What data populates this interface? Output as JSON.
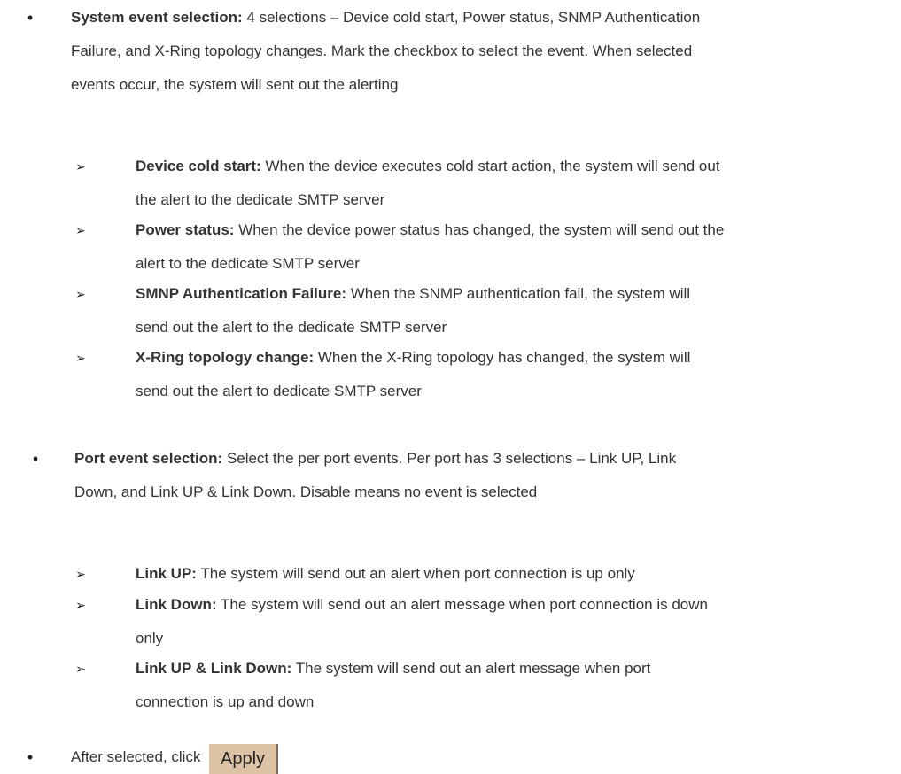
{
  "system_event": {
    "title": "System event selection:",
    "line1": " 4 selections – Device cold start, Power status, SNMP Authentication",
    "line2": "Failure, and X-Ring topology changes. Mark the checkbox to select the event. When selected",
    "line3": "events occur, the system will sent out the alerting",
    "items": [
      {
        "title": "Device cold start:",
        "line1": " When the device executes cold start action, the system will send out",
        "line2": "the alert to the dedicate SMTP server"
      },
      {
        "title": "Power status:",
        "line1": " When the device power status has changed, the system will send out the",
        "line2": "alert to the dedicate SMTP server"
      },
      {
        "title": "SMNP Authentication Failure:",
        "line1": " When the SNMP authentication fail, the system will",
        "line2": "send out the alert to the dedicate SMTP server"
      },
      {
        "title": "X-Ring topology change:",
        "line1": " When the X-Ring topology has changed, the system will",
        "line2": "send out the alert to dedicate SMTP server"
      }
    ]
  },
  "port_event": {
    "title": "Port event selection:",
    "line1": " Select the per port events. Per port has 3 selections – Link UP, Link",
    "line2": "Down, and Link UP & Link Down. Disable means no event is selected",
    "items": [
      {
        "title": "Link UP:",
        "line1": " The system will send out an alert when port connection is up only",
        "line2": ""
      },
      {
        "title": "Link Down:",
        "line1": " The system will send out an alert message when port connection is down",
        "line2": "only"
      },
      {
        "title": "Link UP & Link Down:",
        "line1": " The system will send out an alert message when port",
        "line2": "connection is up and down"
      }
    ]
  },
  "final": {
    "text": "After selected, click",
    "apply_label": "Apply"
  },
  "symbols": {
    "bullet": "•",
    "arrow": "➢"
  }
}
